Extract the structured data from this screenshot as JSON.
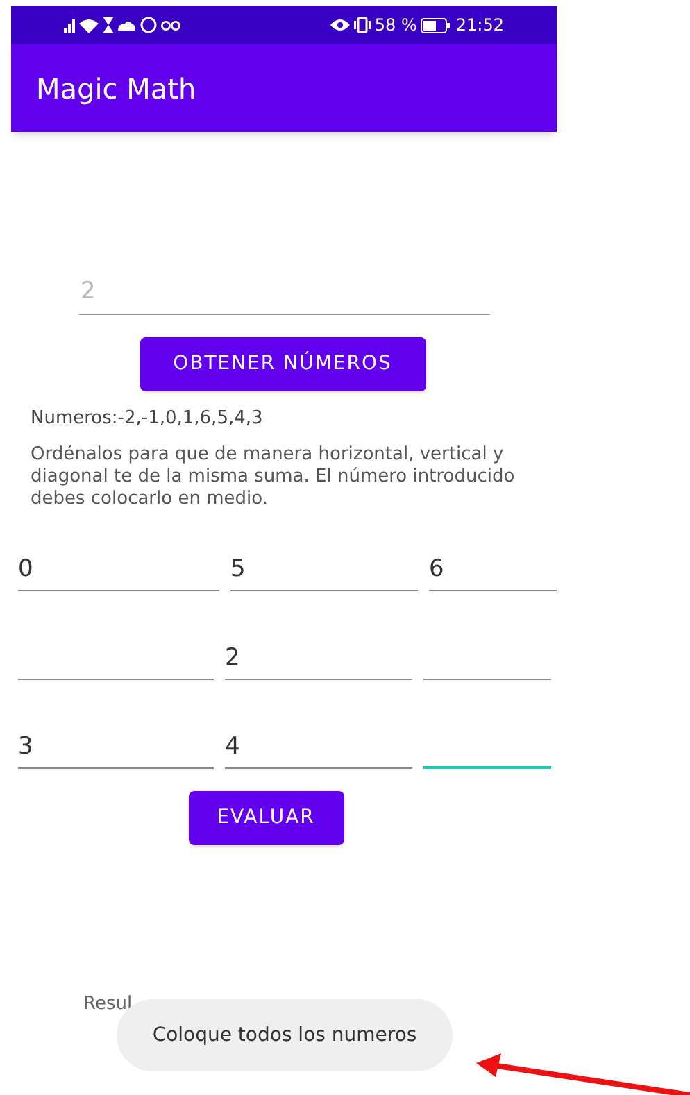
{
  "status_bar": {
    "battery_percent": "58 %",
    "time": "21:52"
  },
  "app_bar": {
    "title": "Magic Math"
  },
  "number_field": {
    "placeholder": "2"
  },
  "get_numbers_button": "OBTENER NÚMEROS",
  "numbers_text": "Numeros:-2,-1,0,1,6,5,4,3",
  "instructions": "Ordénalos para que de manera horizontal, vertical y diagonal te de la misma suma. El número introducido debes colocarlo en medio.",
  "grid": [
    [
      {
        "value": "0",
        "focused": false
      },
      {
        "value": "5",
        "focused": false
      },
      {
        "value": "6",
        "focused": false
      }
    ],
    [
      {
        "focused": false
      },
      {
        "value": "2",
        "focused": false
      },
      {
        "focused": false
      }
    ],
    [
      {
        "value": "3",
        "focused": false
      },
      {
        "value": "4",
        "focused": false
      },
      {
        "focused": true
      }
    ]
  ],
  "evaluate_button": "EVALUAR",
  "result_label": "Resul",
  "toast": "Coloque todos los numeros"
}
